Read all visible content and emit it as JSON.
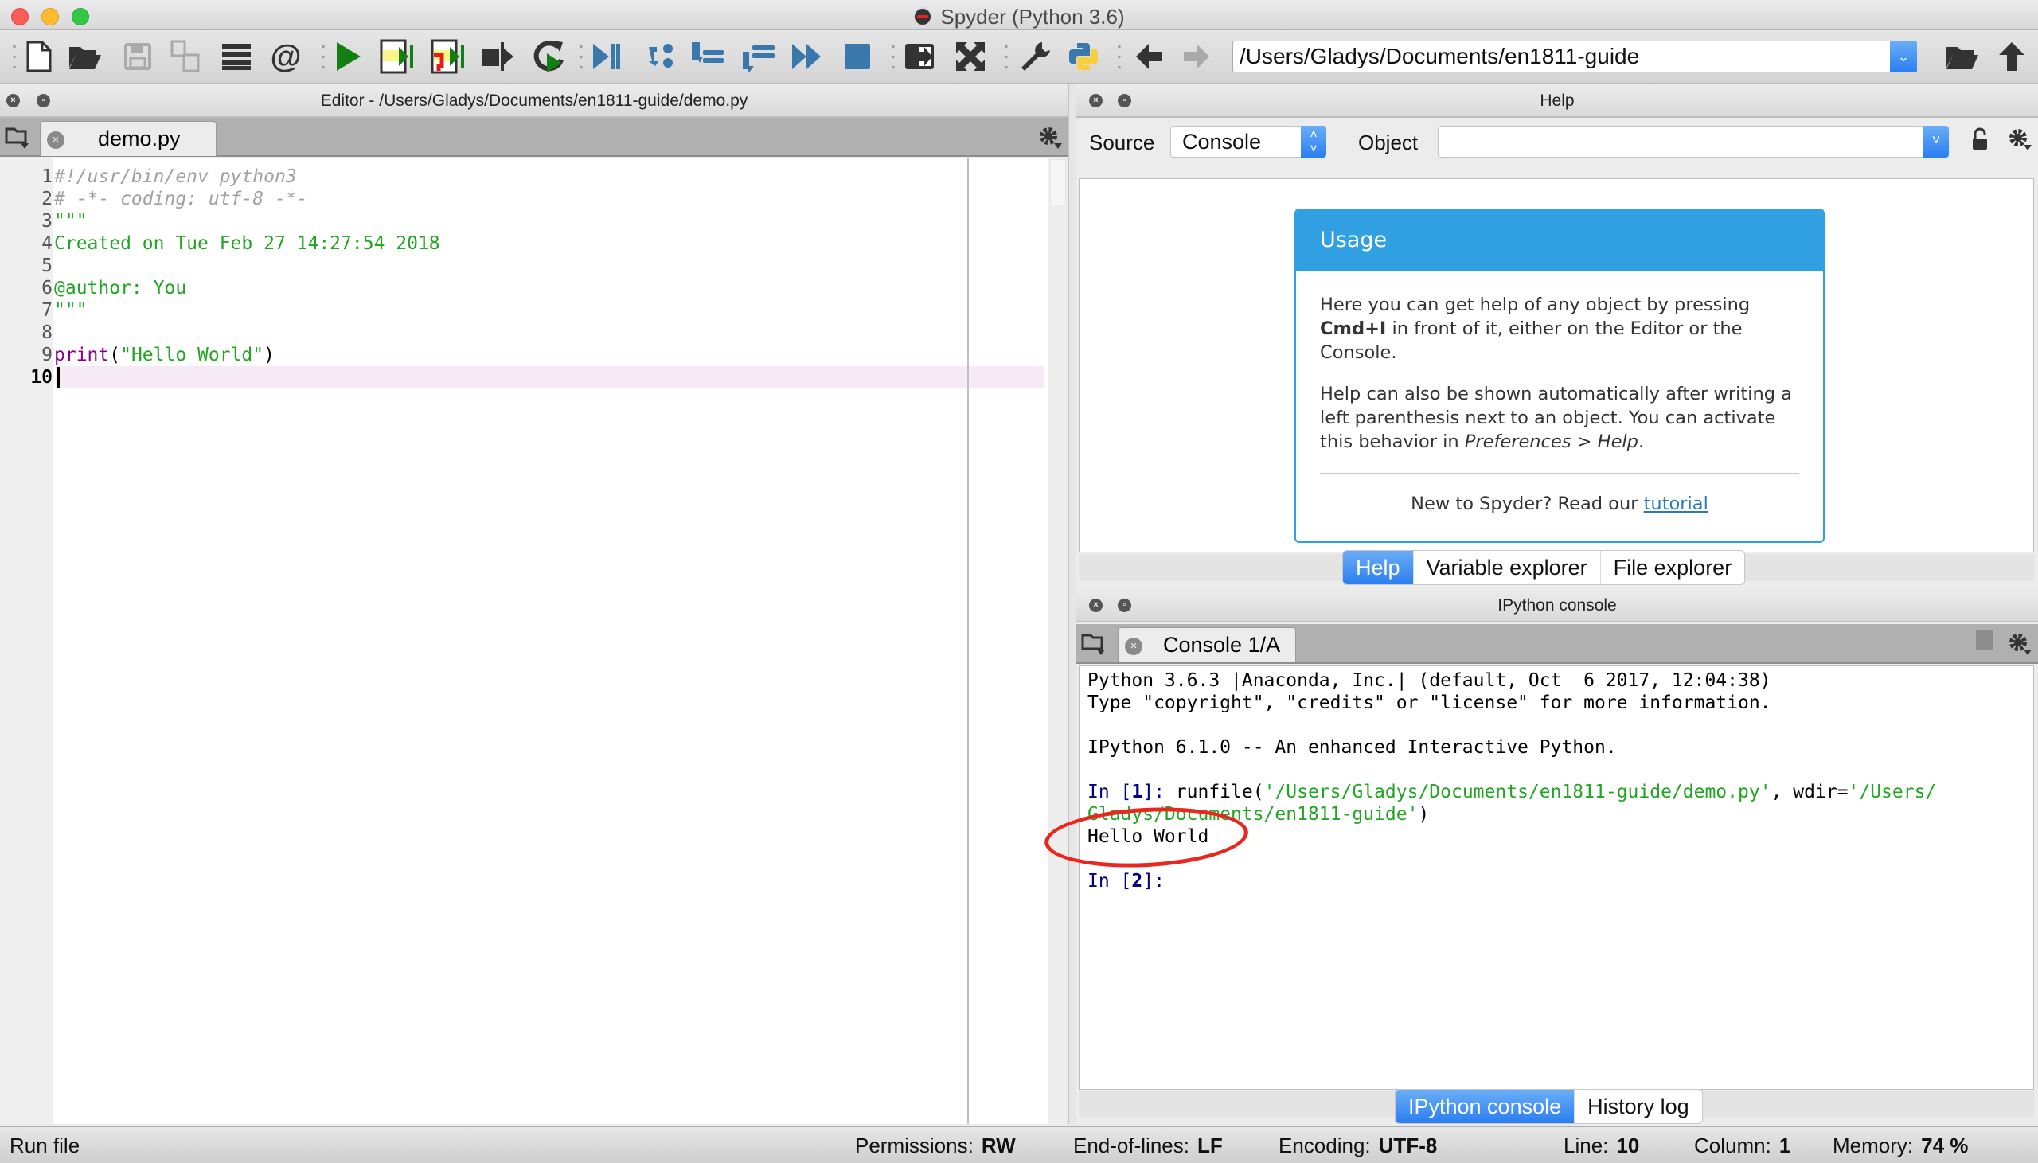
{
  "window": {
    "title": "Spyder (Python 3.6)",
    "traffic_lights": {
      "close": "#fc5b57",
      "minimize": "#fdbc2e",
      "zoom": "#33c748"
    }
  },
  "toolbar": {
    "icons": [
      "new-file-icon",
      "open-file-icon",
      "save-file-icon",
      "save-all-icon",
      "outline-icon",
      "at-icon",
      "run-icon",
      "run-cell-icon",
      "run-cell-advance-icon",
      "run-selection-icon",
      "rerun-icon",
      "debug-icon",
      "step-icon",
      "step-into-icon",
      "step-return-icon",
      "continue-icon",
      "stop-debug-icon",
      "maximize-pane-icon",
      "fullscreen-icon",
      "preferences-icon",
      "pythonpath-icon",
      "back-icon",
      "forward-icon"
    ],
    "working_directory": "/Users/Gladys/Documents/en1811-guide",
    "browse_icon": "folder-open-icon",
    "parent_icon": "arrow-up-icon"
  },
  "editor": {
    "header": "Editor - /Users/Gladys/Documents/en1811-guide/demo.py",
    "tab_label": "demo.py",
    "current_line": 10,
    "lines": [
      {
        "n": "1",
        "segments": [
          {
            "cls": "cmt",
            "text": "#!/usr/bin/env python3"
          }
        ]
      },
      {
        "n": "2",
        "segments": [
          {
            "cls": "cmt",
            "text": "# -*- coding: utf-8 -*-"
          }
        ]
      },
      {
        "n": "3",
        "segments": [
          {
            "cls": "str",
            "text": "\"\"\""
          }
        ]
      },
      {
        "n": "4",
        "segments": [
          {
            "cls": "str",
            "text": "Created on Tue Feb 27 14:27:54 2018"
          }
        ]
      },
      {
        "n": "5",
        "segments": []
      },
      {
        "n": "6",
        "segments": [
          {
            "cls": "str",
            "text": "@author: You"
          }
        ]
      },
      {
        "n": "7",
        "segments": [
          {
            "cls": "str",
            "text": "\"\"\""
          }
        ]
      },
      {
        "n": "8",
        "segments": []
      },
      {
        "n": "9",
        "segments": [
          {
            "cls": "kw",
            "text": "print"
          },
          {
            "cls": "",
            "text": "("
          },
          {
            "cls": "str",
            "text": "\"Hello World\""
          },
          {
            "cls": "",
            "text": ")"
          }
        ]
      },
      {
        "n": "10",
        "segments": []
      }
    ]
  },
  "help": {
    "header": "Help",
    "source_label": "Source",
    "source_value": "Console",
    "object_label": "Object",
    "object_value": "",
    "usage": {
      "title": "Usage",
      "p1_before": "Here you can get help of any object by pressing ",
      "p1_bold": "Cmd+I",
      "p1_after": " in front of it, either on the Editor or the Console.",
      "p2_before": "Help can also be shown automatically after writing a left parenthesis next to an object. You can activate this behavior in ",
      "p2_italic": "Preferences > Help",
      "p2_after": ".",
      "footer_text": "New to Spyder? Read our ",
      "footer_link": "tutorial"
    },
    "tabs": [
      {
        "label": "Help",
        "active": true
      },
      {
        "label": "Variable explorer",
        "active": false
      },
      {
        "label": "File explorer",
        "active": false
      }
    ]
  },
  "console": {
    "header": "IPython console",
    "tab_label": "Console 1/A",
    "banner1": "Python 3.6.3 |Anaconda, Inc.| (default, Oct  6 2017, 12:04:38)",
    "banner2": "Type \"copyright\", \"credits\" or \"license\" for more information.",
    "banner3": "IPython 6.1.0 -- An enhanced Interactive Python.",
    "in1_prompt_pre": "In [",
    "in1_num": "1",
    "in1_prompt_post": "]: ",
    "in1_cmd": "runfile(",
    "in1_arg1": "'/Users/Gladys/Documents/en1811-guide/demo.py'",
    "in1_mid": ", wdir=",
    "in1_arg2a": "'/Users/",
    "in1_arg2b": "Gladys/Documents/en1811-guide'",
    "in1_close": ")",
    "output": "Hello World",
    "in2_prompt_pre": "In [",
    "in2_num": "2",
    "in2_prompt_post": "]:",
    "tabs": [
      {
        "label": "IPython console",
        "active": true
      },
      {
        "label": "History log",
        "active": false
      }
    ],
    "annotation": "red-ellipse-highlight"
  },
  "statusbar": {
    "message": "Run file",
    "permissions_label": "Permissions:",
    "permissions_value": "RW",
    "eol_label": "End-of-lines:",
    "eol_value": "LF",
    "encoding_label": "Encoding:",
    "encoding_value": "UTF-8",
    "line_label": "Line:",
    "line_value": "10",
    "column_label": "Column:",
    "column_value": "1",
    "memory_label": "Memory:",
    "memory_value": "74 %"
  }
}
